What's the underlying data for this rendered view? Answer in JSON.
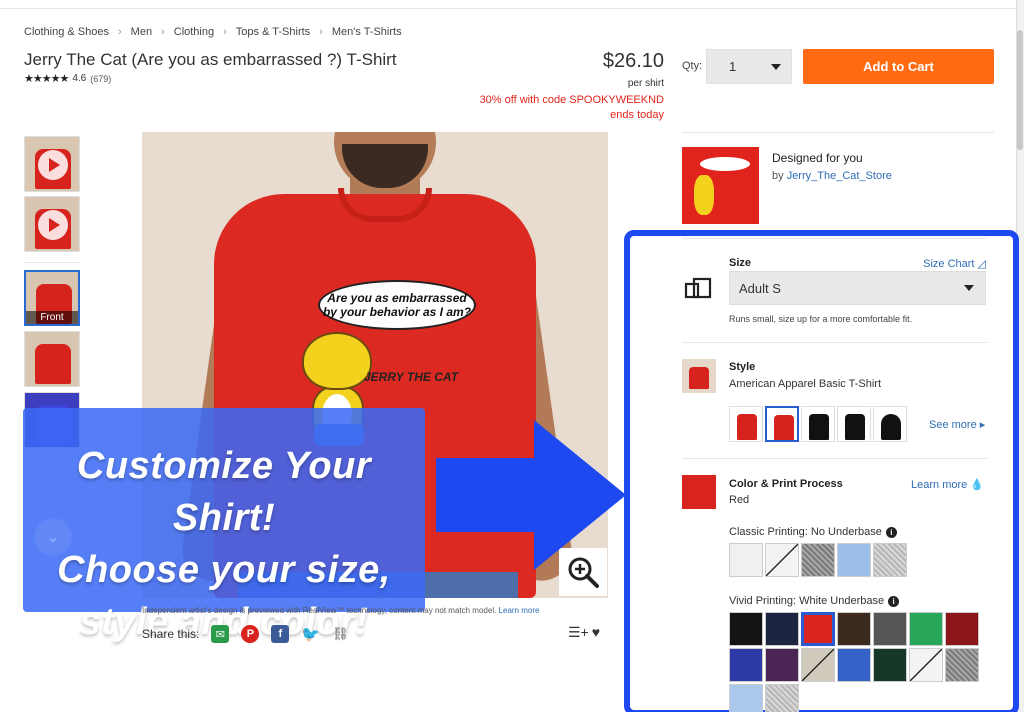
{
  "breadcrumbs": [
    "Clothing & Shoes",
    "Men",
    "Clothing",
    "Tops & T-Shirts",
    "Men's T-Shirts"
  ],
  "product": {
    "title": "Jerry The Cat (Are you as embarrassed ?) T-Shirt",
    "rating": "4.6",
    "review_count": "(679)",
    "price": "$26.10",
    "per_unit": "per shirt",
    "promo_line1": "30% off with code SPOOKYWEEKND",
    "promo_line2": "ends today"
  },
  "purchase": {
    "qty_label": "Qty:",
    "qty_value": "1",
    "add_to_cart": "Add to Cart"
  },
  "image": {
    "bubble_line1": "Are you as embarrassed",
    "bubble_line2": "by your behavior as I am?",
    "logo_text": "JERRY THE CAT",
    "thumb_front_label": "Front",
    "disclaimer": "Independent artist's design is previewed with RealView™ technology, content may not match model.",
    "disclaimer_link": "Learn more"
  },
  "overlay": {
    "line1": "Customize Your Shirt!",
    "line2": "Choose your size,",
    "line3": "style and color!"
  },
  "share": {
    "label": "Share this:"
  },
  "designer": {
    "heading": "Designed for you",
    "by": "by",
    "store": "Jerry_The_Cat_Store"
  },
  "size": {
    "label": "Size",
    "chart_link": "Size Chart",
    "value": "Adult S",
    "note": "Runs small, size up for a more comfortable fit."
  },
  "style": {
    "label": "Style",
    "value": "American Apparel Basic T-Shirt",
    "see_more": "See more",
    "options": [
      "#d7231d",
      "#d7231d",
      "#111111",
      "#111111",
      "#111111"
    ]
  },
  "color": {
    "label": "Color & Print Process",
    "value": "Red",
    "learn_more": "Learn more",
    "classic_label": "Classic Printing: No Underbase",
    "vivid_label": "Vivid Printing: White Underbase",
    "accent": "#d8231f"
  }
}
